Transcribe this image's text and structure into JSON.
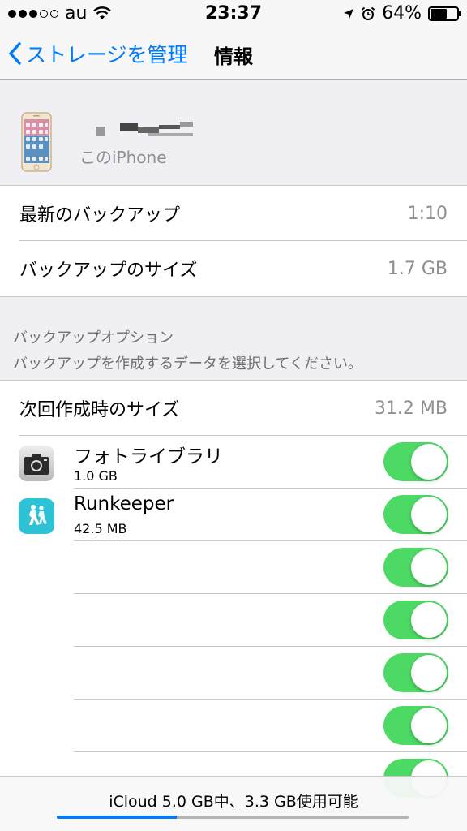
{
  "status_bar": {
    "carrier": "au",
    "time": "23:37",
    "battery_percent": "64%",
    "battery_level": 0.64
  },
  "nav": {
    "back_label": "ストレージを管理",
    "title": "情報"
  },
  "device": {
    "subtitle": "このiPhone"
  },
  "backup_info": {
    "latest_label": "最新のバックアップ",
    "latest_value": "1:10",
    "size_label": "バックアップのサイズ",
    "size_value": "1.7 GB"
  },
  "backup_options": {
    "header": "バックアップオプション",
    "subheader": "バックアップを作成するデータを選択してください。",
    "next_label": "次回作成時のサイズ",
    "next_value": "31.2 MB"
  },
  "apps": [
    {
      "name": "フォトライブラリ",
      "size": "1.0 GB",
      "icon": "camera-icon",
      "on": true
    },
    {
      "name": "Runkeeper",
      "size": "42.5 MB",
      "icon": "runkeeper-icon",
      "on": true
    },
    {
      "name": "",
      "size": "",
      "icon": "",
      "on": true
    },
    {
      "name": "",
      "size": "",
      "icon": "",
      "on": true
    },
    {
      "name": "",
      "size": "",
      "icon": "",
      "on": true
    },
    {
      "name": "",
      "size": "",
      "icon": "",
      "on": true
    },
    {
      "name": "",
      "size": "",
      "icon": "",
      "on": true
    }
  ],
  "storage": {
    "text": "iCloud 5.0 GB中、3.3 GB使用可能",
    "used_fraction": 0.34
  },
  "colors": {
    "accent": "#007aff",
    "toggle_on": "#4cd964",
    "secondary_text": "#8e8e93"
  }
}
